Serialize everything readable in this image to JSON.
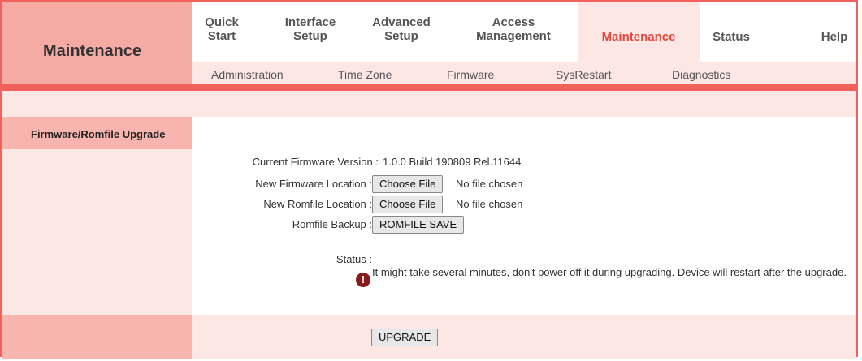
{
  "header": {
    "brand_title": "Maintenance",
    "nav": [
      {
        "line1": "Quick",
        "line2": "Start"
      },
      {
        "line1": "Interface",
        "line2": "Setup"
      },
      {
        "line1": "Advanced",
        "line2": "Setup"
      },
      {
        "line1": "Access",
        "line2": "Management"
      },
      {
        "label": "Maintenance",
        "active": true
      },
      {
        "label": "Status"
      },
      {
        "label": "Help"
      }
    ],
    "subnav": [
      "Administration",
      "Time Zone",
      "Firmware",
      "SysRestart",
      "Diagnostics"
    ]
  },
  "section_title": "Firmware/Romfile Upgrade",
  "form": {
    "current_fw_label": "Current Firmware Version :",
    "current_fw_value": "1.0.0 Build 190809 Rel.11644",
    "new_fw_label": "New Firmware Location :",
    "new_rom_label": "New Romfile Location :",
    "choose_file_label": "Choose File",
    "no_file_text": "No file chosen",
    "rom_backup_label": "Romfile Backup :",
    "rom_save_label": "ROMFILE SAVE",
    "status_label": "Status :",
    "status_message": "It might take several minutes, don't power off it during upgrading. Device will restart after the upgrade.",
    "warning_icon": "!",
    "upgrade_label": "UPGRADE"
  },
  "colors": {
    "accent": "#f2625c",
    "active_text": "#e8473e",
    "panel": "#fce7e5"
  }
}
